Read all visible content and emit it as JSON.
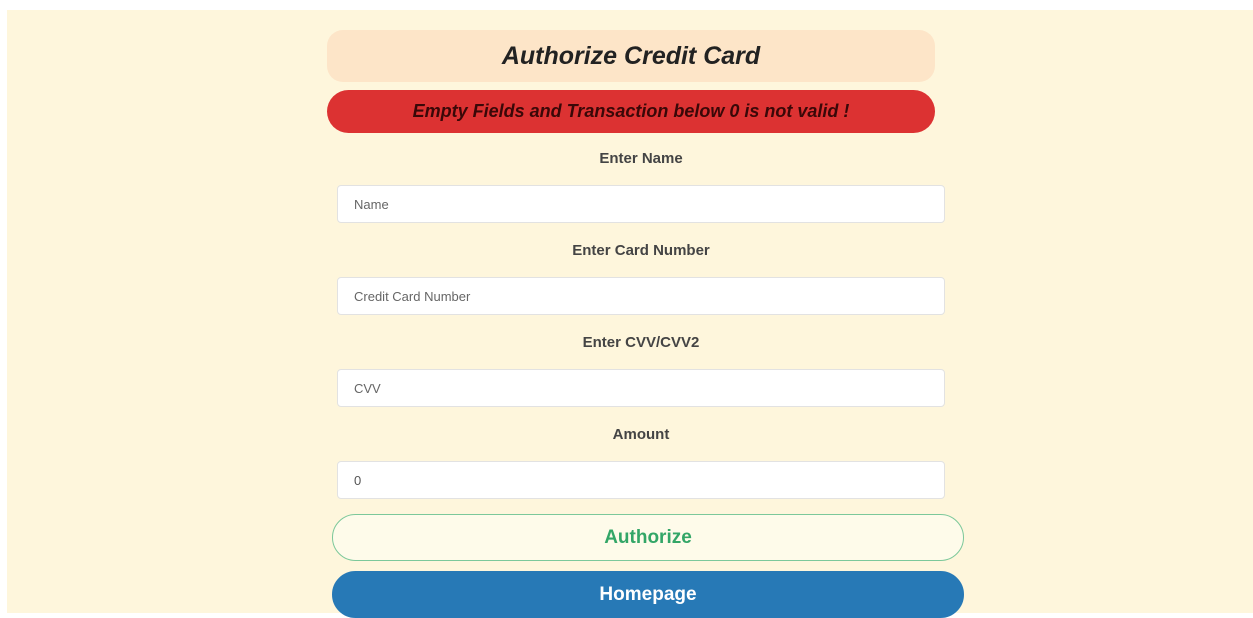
{
  "header": {
    "title": "Authorize Credit Card"
  },
  "alert": {
    "message": "Empty Fields and Transaction below 0 is not valid !"
  },
  "form": {
    "name": {
      "label": "Enter Name",
      "placeholder": "Name",
      "value": ""
    },
    "card_number": {
      "label": "Enter Card Number",
      "placeholder": "Credit Card Number",
      "value": ""
    },
    "cvv": {
      "label": "Enter CVV/CVV2",
      "placeholder": "CVV",
      "value": ""
    },
    "amount": {
      "label": "Amount",
      "placeholder": "",
      "value": "0"
    }
  },
  "buttons": {
    "authorize": "Authorize",
    "homepage": "Homepage"
  },
  "colors": {
    "page_background": "#fef6dc",
    "header_background": "#fde5c8",
    "alert_background": "#dc3232",
    "authorize_accent": "#33a667",
    "homepage_background": "#2779b6"
  }
}
